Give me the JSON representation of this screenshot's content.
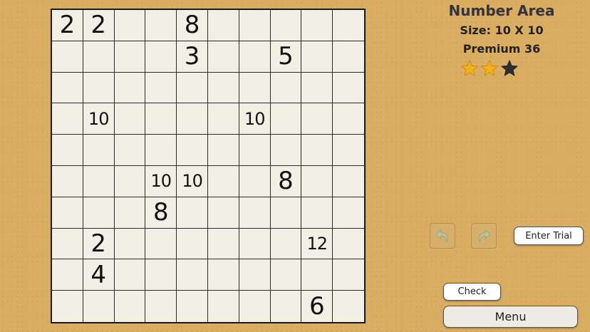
{
  "puzzle": {
    "title": "Number Area",
    "size_label": "Size: 10 X 10",
    "premium_label": "Premium 36",
    "rating": {
      "filled": 2,
      "total": 3
    },
    "colors": {
      "star_filled": "#f3b21b",
      "star_empty": "#2f2f2f"
    }
  },
  "grid": {
    "rows": 10,
    "cols": 10,
    "cells": [
      [
        "2",
        "2",
        "",
        "",
        "8",
        "",
        "",
        "",
        "",
        ""
      ],
      [
        "",
        "",
        "",
        "",
        "3",
        "",
        "",
        "5",
        "",
        ""
      ],
      [
        "",
        "",
        "",
        "",
        "",
        "",
        "",
        "",
        "",
        ""
      ],
      [
        "",
        "10",
        "",
        "",
        "",
        "",
        "10",
        "",
        "",
        ""
      ],
      [
        "",
        "",
        "",
        "",
        "",
        "",
        "",
        "",
        "",
        ""
      ],
      [
        "",
        "",
        "",
        "10",
        "10",
        "",
        "",
        "8",
        "",
        ""
      ],
      [
        "",
        "",
        "",
        "8",
        "",
        "",
        "",
        "",
        "",
        ""
      ],
      [
        "",
        "2",
        "",
        "",
        "",
        "",
        "",
        "",
        "12",
        ""
      ],
      [
        "",
        "4",
        "",
        "",
        "",
        "",
        "",
        "",
        "",
        ""
      ],
      [
        "",
        "",
        "",
        "",
        "",
        "",
        "",
        "",
        "6",
        ""
      ]
    ]
  },
  "controls": {
    "undo_icon": "curved-arrow-left-icon",
    "redo_icon": "curved-arrow-right-icon",
    "enter_trial_label": "Enter Trial",
    "check_label": "Check",
    "menu_label": "Menu"
  }
}
